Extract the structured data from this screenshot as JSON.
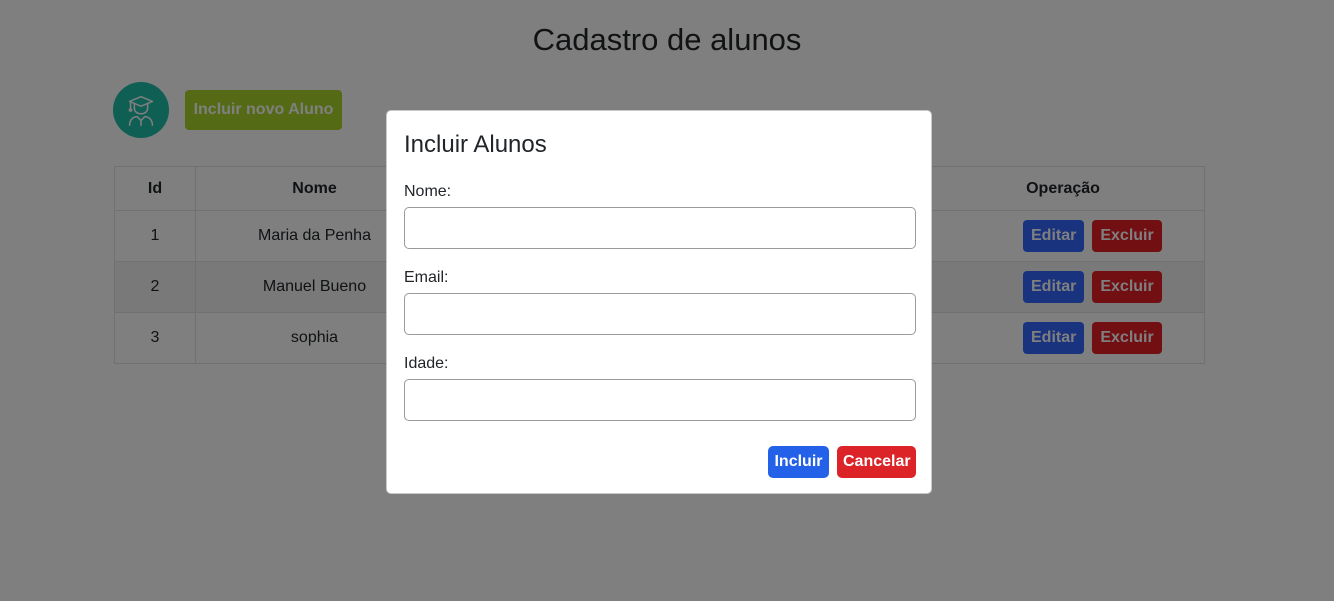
{
  "page": {
    "title": "Cadastro de alunos"
  },
  "toolbar": {
    "add_label": "Incluir novo Aluno",
    "avatar_icon": "graduate-student-icon"
  },
  "table": {
    "headers": {
      "id": "Id",
      "nome": "Nome",
      "email": "",
      "idade": "",
      "operacao": "Operação"
    },
    "rows": [
      {
        "id": "1",
        "nome": "Maria da Penha",
        "edit": "Editar",
        "delete": "Excluir"
      },
      {
        "id": "2",
        "nome": "Manuel Bueno",
        "edit": "Editar",
        "delete": "Excluir"
      },
      {
        "id": "3",
        "nome": "sophia",
        "edit": "Editar",
        "delete": "Excluir"
      }
    ]
  },
  "modal": {
    "title": "Incluir Alunos",
    "fields": [
      {
        "label": "Nome:",
        "value": "",
        "placeholder": ""
      },
      {
        "label": "Email:",
        "value": "",
        "placeholder": ""
      },
      {
        "label": "Idade:",
        "value": "",
        "placeholder": ""
      }
    ],
    "submit_label": "Incluir",
    "cancel_label": "Cancelar"
  },
  "colors": {
    "accent_green": "#a9d52a",
    "avatar_teal": "#1fbfa8",
    "primary_blue": "#3366ff",
    "danger_red": "#e21e26",
    "modal_submit_blue": "#2361e8",
    "modal_cancel_red": "#dc2327"
  }
}
